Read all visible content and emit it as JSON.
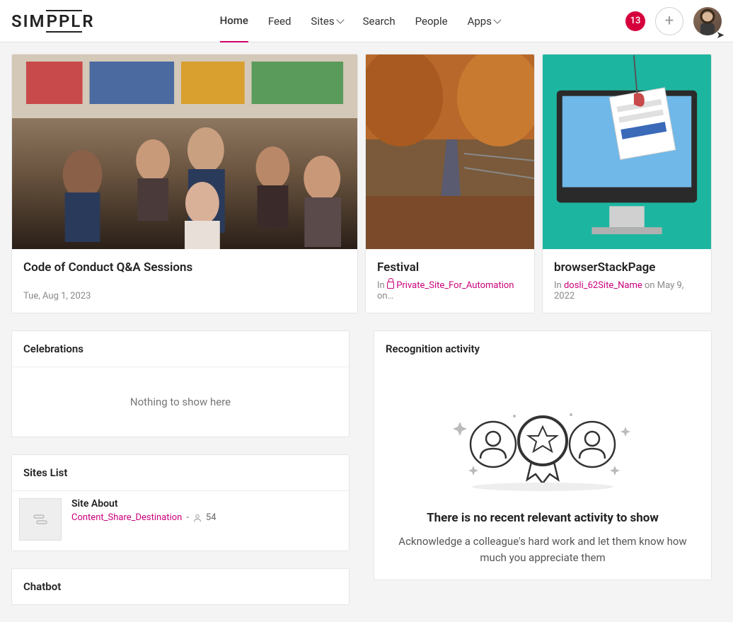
{
  "header": {
    "logo_text": "SIMPPLR",
    "nav": {
      "home": "Home",
      "feed": "Feed",
      "sites": "Sites",
      "search": "Search",
      "people": "People",
      "apps": "Apps"
    },
    "notif_count": "13"
  },
  "featured": [
    {
      "title": "Code of Conduct Q&A Sessions",
      "meta_prefix": "",
      "date": "Tue, Aug 1, 2023",
      "site": "",
      "site_private": false,
      "suffix": ""
    },
    {
      "title": "Festival",
      "meta_prefix": "In ",
      "date": "",
      "site": "Private_Site_For_Automation",
      "site_private": true,
      "suffix": " on…"
    },
    {
      "title": "browserStackPage",
      "meta_prefix": "In ",
      "date": "",
      "site": "dosli_62Site_Name",
      "site_private": false,
      "suffix": " on May 9, 2022"
    }
  ],
  "celebrations": {
    "title": "Celebrations",
    "empty": "Nothing to show here"
  },
  "sites_list": {
    "title": "Sites List",
    "items": [
      {
        "name": "Site About",
        "link": "Content_Share_Destination",
        "dash": " - ",
        "count": "54"
      }
    ]
  },
  "chatbot": {
    "title": "Chatbot"
  },
  "recognition": {
    "title": "Recognition activity",
    "headline": "There is no recent relevant activity to show",
    "desc": "Acknowledge a colleague's hard work and let them know how much you appreciate them"
  }
}
